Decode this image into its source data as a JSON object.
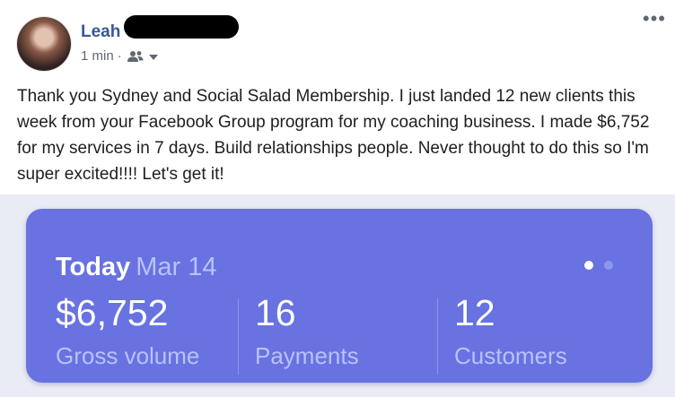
{
  "post": {
    "author_name": "Leah",
    "timestamp": "1 min",
    "meta_separator": "·",
    "audience_icon": "people-icon",
    "more_icon": "more-horizontal-icon",
    "more_label": "•••",
    "text": "Thank you Sydney and Social Salad Membership. I just landed 12 new clients this week from your Facebook Group program for my coaching business. I made $6,752 for my services in 7 days. Build relationships people. Never thought to do this so I'm super excited!!!! Let's get it!"
  },
  "card": {
    "title_bold": "Today",
    "title_date": "Mar 14",
    "pager": {
      "count": 2,
      "active_index": 0
    },
    "metrics": [
      {
        "value": "$6,752",
        "label": "Gross volume"
      },
      {
        "value": "16",
        "label": "Payments"
      },
      {
        "value": "12",
        "label": "Customers"
      }
    ],
    "colors": {
      "card_bg": "#6872e1",
      "label": "#b9c2ff",
      "value": "#ffffff",
      "dot_active": "#ffffff",
      "dot_inactive": "#8f97ec"
    }
  },
  "colors": {
    "author_link": "#385898",
    "meta_text": "#616770",
    "body_text": "#1c1e21"
  }
}
